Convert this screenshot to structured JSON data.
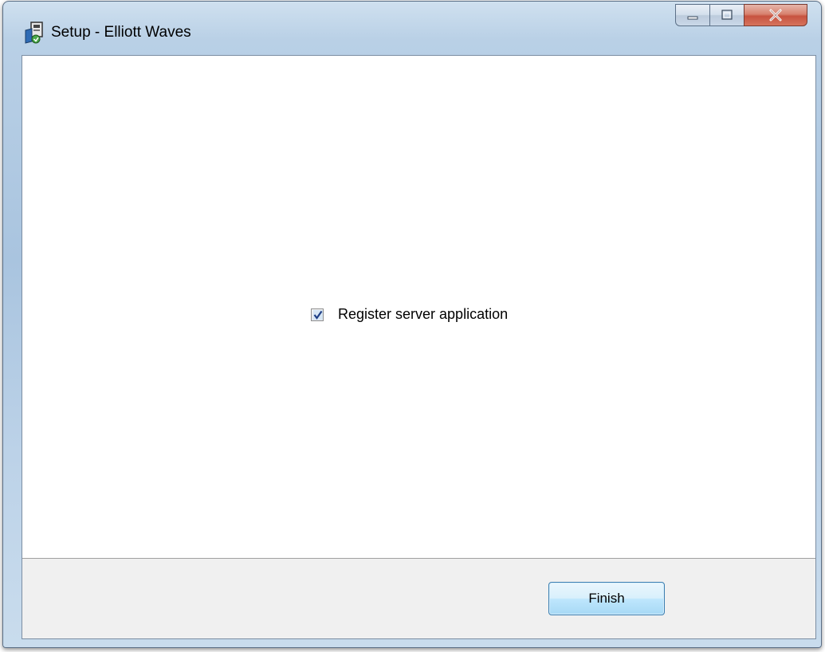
{
  "window": {
    "title": "Setup - Elliott Waves"
  },
  "titlebar_buttons": {
    "minimize_icon": "minimize-icon",
    "maximize_icon": "maximize-icon",
    "close_icon": "close-icon"
  },
  "content": {
    "register_checkbox": {
      "label": "Register server application",
      "checked": true
    }
  },
  "footer": {
    "finish_label": "Finish"
  },
  "colors": {
    "finish_button_border": "#3c7fb1",
    "close_button": "#c75340"
  }
}
